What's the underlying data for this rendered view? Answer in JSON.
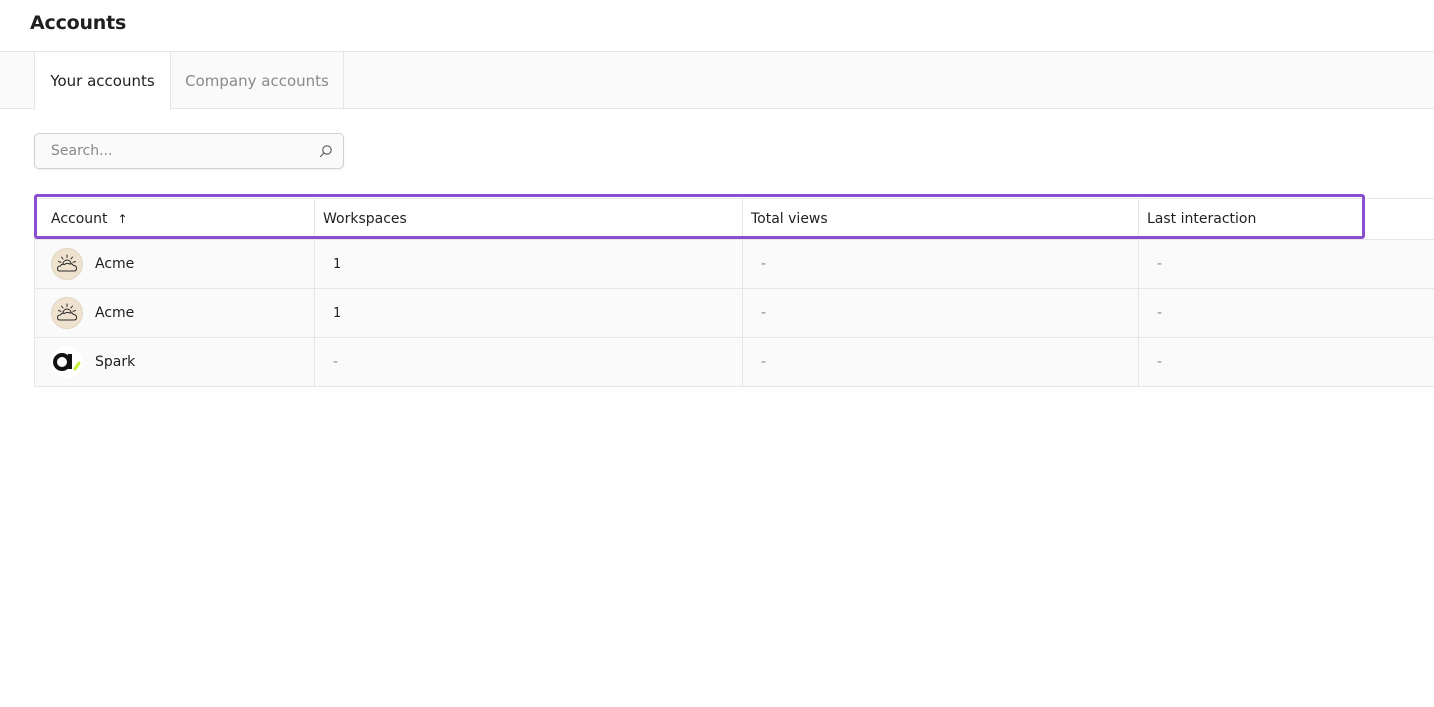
{
  "header": {
    "title": "Accounts"
  },
  "tabs": [
    {
      "label": "Your accounts",
      "active": true
    },
    {
      "label": "Company accounts",
      "active": false
    }
  ],
  "search": {
    "placeholder": "Search...",
    "value": "",
    "icon": "search-icon"
  },
  "table": {
    "columns": [
      "Account",
      "Workspaces",
      "Total views",
      "Last interaction"
    ],
    "sort": {
      "column": "Account",
      "direction": "ascending",
      "arrow": "↑"
    },
    "rows": [
      {
        "account": "Acme",
        "logo": "acme-cloud-logo",
        "workspaces": "1",
        "total_views": "-",
        "last_interaction": "-"
      },
      {
        "account": "Acme",
        "logo": "acme-cloud-logo",
        "workspaces": "1",
        "total_views": "-",
        "last_interaction": "-"
      },
      {
        "account": "Spark",
        "logo": "spark-a-logo",
        "workspaces": "-",
        "total_views": "-",
        "last_interaction": "-"
      }
    ]
  },
  "colors": {
    "highlight": "#8a4fcf",
    "border": "#e6e6e6",
    "muted_text": "#8a8a8a",
    "spark_accent": "#c6f13a"
  }
}
